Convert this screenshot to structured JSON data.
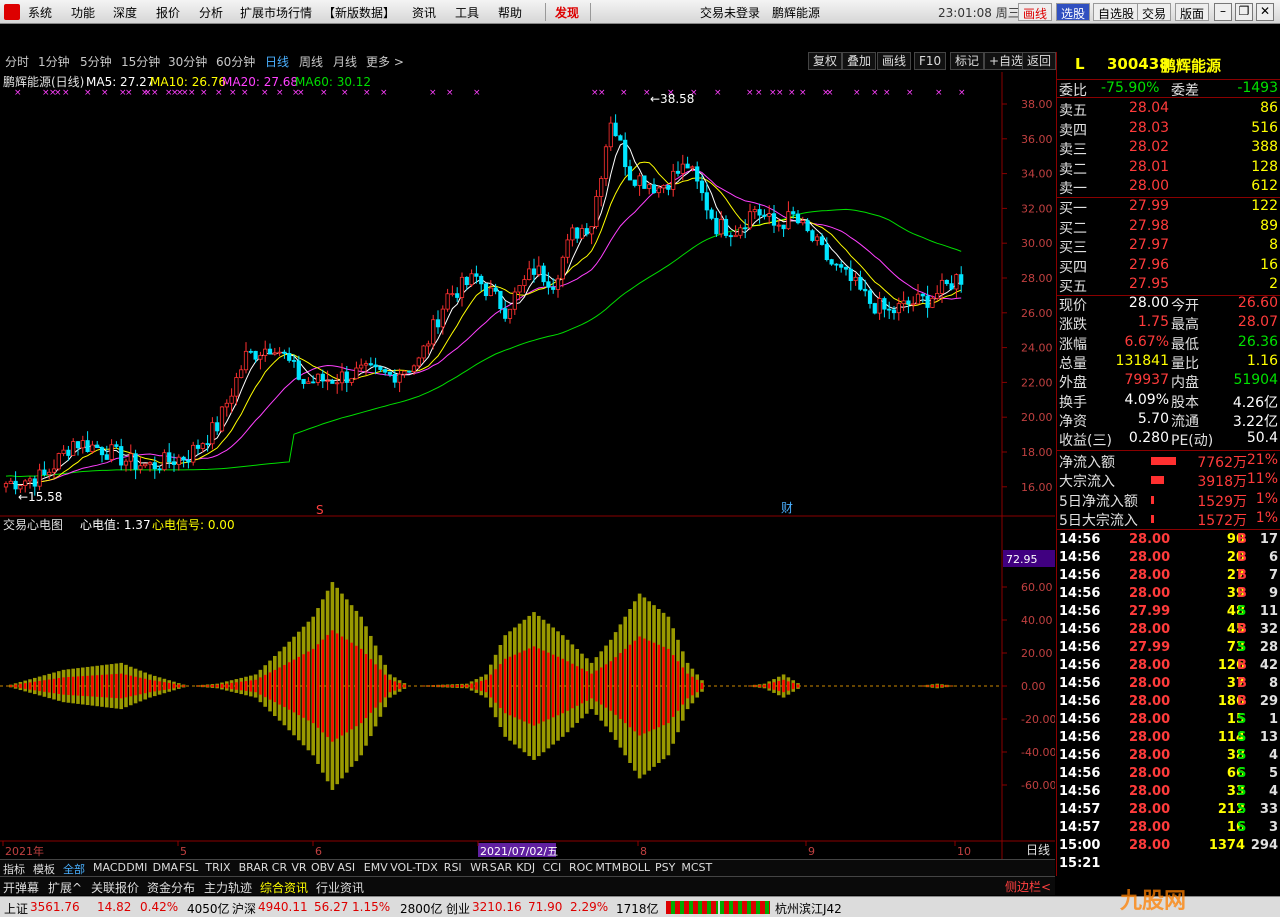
{
  "menu": {
    "items": [
      "系统",
      "功能",
      "深度",
      "报价",
      "分析",
      "扩展市场行情",
      "【新版数据】",
      "资讯",
      "工具",
      "帮助"
    ],
    "discover": "发现",
    "center": "交易未登录　鹏辉能源",
    "time": "23:01:08 周三",
    "right_buttons": [
      "画线",
      "选股",
      "自选股",
      "交易",
      "版面"
    ]
  },
  "periods": [
    "分时",
    "1分钟",
    "5分钟",
    "15分钟",
    "30分钟",
    "60分钟",
    "日线",
    "周线",
    "月线",
    "更多 >"
  ],
  "toolbar": [
    "复权",
    "叠加",
    "画线",
    "F10",
    "标记",
    "+自选",
    "返回"
  ],
  "main_legend": {
    "name": "鹏辉能源(日线)",
    "ma5": "MA5: 27.27",
    "ma10": "MA10: 26.76",
    "ma20": "MA20: 27.68",
    "ma60": "MA60: 30.12"
  },
  "colors": {
    "up": "#ff3030",
    "down": "#00e5ff",
    "ma5": "#ffffff",
    "ma10": "#ffff00",
    "ma20": "#ff40ff",
    "ma60": "#00dd00",
    "ind_red": "#ff0000",
    "ind_olive": "#999900"
  },
  "chart_data": [
    {
      "type": "candlestick",
      "title": "鹏辉能源(日线)",
      "ylim": [
        15,
        39
      ],
      "y_ticks": [
        "38.00",
        "36.00",
        "34.00",
        "32.00",
        "30.00",
        "28.00",
        "26.00",
        "24.00",
        "22.00",
        "20.00",
        "18.00",
        "16.00"
      ],
      "annotations": {
        "high": "38.58",
        "low": "15.58",
        "markers": [
          "S",
          "财"
        ]
      },
      "series": [
        {
          "name": "MA5",
          "last": 27.27
        },
        {
          "name": "MA10",
          "last": 26.76
        },
        {
          "name": "MA20",
          "last": 27.68
        },
        {
          "name": "MA60",
          "last": 30.12
        }
      ],
      "x_labels": [
        "2021年",
        "5",
        "6",
        "2021/07/02/五",
        "8",
        "9",
        "10"
      ],
      "anchors": [
        [
          0,
          16.2
        ],
        [
          8,
          16.6
        ],
        [
          14,
          18.6
        ],
        [
          20,
          18.2
        ],
        [
          26,
          17.4
        ],
        [
          30,
          17.2
        ],
        [
          38,
          17.8
        ],
        [
          44,
          19.5
        ],
        [
          50,
          23.5
        ],
        [
          56,
          24.2
        ],
        [
          62,
          22.0
        ],
        [
          68,
          22.2
        ],
        [
          74,
          22.6
        ],
        [
          80,
          22.4
        ],
        [
          86,
          23.2
        ],
        [
          92,
          27.0
        ],
        [
          98,
          28.0
        ],
        [
          104,
          26.2
        ],
        [
          110,
          28.5
        ],
        [
          114,
          27.8
        ],
        [
          118,
          30.5
        ],
        [
          122,
          31.2
        ],
        [
          126,
          37.2
        ],
        [
          130,
          34.0
        ],
        [
          136,
          33.2
        ],
        [
          142,
          34.5
        ],
        [
          148,
          31.0
        ],
        [
          152,
          30.8
        ],
        [
          156,
          32.0
        ],
        [
          160,
          31.0
        ],
        [
          164,
          31.5
        ],
        [
          168,
          30.2
        ],
        [
          172,
          28.8
        ],
        [
          176,
          27.8
        ],
        [
          180,
          26.6
        ],
        [
          184,
          26.0
        ],
        [
          188,
          26.5
        ],
        [
          192,
          26.8
        ],
        [
          196,
          27.5
        ],
        [
          198,
          28.0
        ]
      ]
    },
    {
      "type": "bar",
      "title": "交易心电图",
      "legend": {
        "value": "心电值: 1.37",
        "signal": "心电信号: 0.00"
      },
      "ylim": [
        -60,
        70
      ],
      "y_ticks": [
        "60.00",
        "40.00",
        "20.00",
        "0.00",
        "-20.00",
        "-40.00",
        "-60.00"
      ],
      "current": "72.95",
      "anchors": [
        [
          0,
          0
        ],
        [
          12,
          7
        ],
        [
          24,
          10
        ],
        [
          30,
          5
        ],
        [
          38,
          0
        ],
        [
          44,
          1
        ],
        [
          52,
          5
        ],
        [
          58,
          17
        ],
        [
          64,
          30
        ],
        [
          68,
          45
        ],
        [
          74,
          30
        ],
        [
          80,
          5
        ],
        [
          84,
          0
        ],
        [
          96,
          1
        ],
        [
          100,
          5
        ],
        [
          104,
          22
        ],
        [
          110,
          32
        ],
        [
          116,
          22
        ],
        [
          122,
          10
        ],
        [
          126,
          20
        ],
        [
          132,
          40
        ],
        [
          138,
          30
        ],
        [
          142,
          10
        ],
        [
          146,
          0
        ],
        [
          154,
          0
        ],
        [
          158,
          1
        ],
        [
          162,
          5
        ],
        [
          166,
          0
        ],
        [
          190,
          0
        ],
        [
          194,
          1
        ],
        [
          198,
          0
        ]
      ]
    }
  ],
  "right_panel": {
    "code": "300438",
    "name": "鹏辉能源",
    "flag": "L",
    "weibi": {
      "label": "委比",
      "value": "-75.90%",
      "label2": "委差",
      "value2": "-1493"
    },
    "asks": [
      {
        "label": "卖五",
        "price": "28.04",
        "vol": "86"
      },
      {
        "label": "卖四",
        "price": "28.03",
        "vol": "516"
      },
      {
        "label": "卖三",
        "price": "28.02",
        "vol": "388"
      },
      {
        "label": "卖二",
        "price": "28.01",
        "vol": "128"
      },
      {
        "label": "卖一",
        "price": "28.00",
        "vol": "612"
      }
    ],
    "bids": [
      {
        "label": "买一",
        "price": "27.99",
        "vol": "122"
      },
      {
        "label": "买二",
        "price": "27.98",
        "vol": "89"
      },
      {
        "label": "买三",
        "price": "27.97",
        "vol": "8"
      },
      {
        "label": "买四",
        "price": "27.96",
        "vol": "16"
      },
      {
        "label": "买五",
        "price": "27.95",
        "vol": "2"
      }
    ],
    "stats": [
      [
        "现价",
        "28.00",
        "今开",
        "26.60"
      ],
      [
        "涨跌",
        "1.75",
        "最高",
        "28.07"
      ],
      [
        "涨幅",
        "6.67%",
        "最低",
        "26.36"
      ],
      [
        "总量",
        "131841",
        "量比",
        "1.16"
      ],
      [
        "外盘",
        "79937",
        "内盘",
        "51904"
      ],
      [
        "换手",
        "4.09%",
        "股本",
        "4.26亿"
      ],
      [
        "净资",
        "5.70",
        "流通",
        "3.22亿"
      ],
      [
        "收益(三)",
        "0.280",
        "PE(动)",
        "50.4"
      ]
    ],
    "flows": [
      {
        "label": "净流入额",
        "value": "7762万",
        "pct": "21%",
        "bar": 0.95
      },
      {
        "label": "大宗流入",
        "value": "3918万",
        "pct": "11%",
        "bar": 0.5
      },
      {
        "label": "5日净流入额",
        "value": "1529万",
        "pct": "1%",
        "bar": 0.1
      },
      {
        "label": "5日大宗流入",
        "value": "1572万",
        "pct": "1%",
        "bar": 0.1
      }
    ],
    "ticks": [
      [
        "14:56",
        "28.00",
        "90",
        "B",
        "17"
      ],
      [
        "14:56",
        "28.00",
        "20",
        "B",
        "6"
      ],
      [
        "14:56",
        "28.00",
        "27",
        "B",
        "7"
      ],
      [
        "14:56",
        "28.00",
        "39",
        "B",
        "9"
      ],
      [
        "14:56",
        "27.99",
        "48",
        "S",
        "11"
      ],
      [
        "14:56",
        "28.00",
        "45",
        "B",
        "32"
      ],
      [
        "14:56",
        "27.99",
        "73",
        "S",
        "28"
      ],
      [
        "14:56",
        "28.00",
        "126",
        "B",
        "42"
      ],
      [
        "14:56",
        "28.00",
        "37",
        "B",
        "8"
      ],
      [
        "14:56",
        "28.00",
        "186",
        "B",
        "29"
      ],
      [
        "14:56",
        "28.00",
        "15",
        "S",
        "1"
      ],
      [
        "14:56",
        "28.00",
        "114",
        "S",
        "13"
      ],
      [
        "14:56",
        "28.00",
        "38",
        "S",
        "4"
      ],
      [
        "14:56",
        "28.00",
        "66",
        "S",
        "5"
      ],
      [
        "14:56",
        "28.00",
        "33",
        "S",
        "4"
      ],
      [
        "14:57",
        "28.00",
        "212",
        "S",
        "33"
      ],
      [
        "14:57",
        "28.00",
        "16",
        "S",
        "3"
      ],
      [
        "15:00",
        "28.00",
        "1374",
        "",
        "294"
      ],
      [
        "15:21",
        "",
        "",
        "",
        ""
      ]
    ]
  },
  "indicators": [
    "指标",
    "模板",
    "全部",
    "MACD",
    "DMI",
    "DMA",
    "FSL",
    "TRIX",
    "BRAR",
    "CR",
    "VR",
    "OBV",
    "ASI",
    "EMV",
    "VOL-TDX",
    "RSI",
    "WR",
    "SAR",
    "KDJ",
    "CCI",
    "ROC",
    "MTM",
    "BOLL",
    "PSY",
    "MCST"
  ],
  "bottom_tabs": [
    "开弹幕",
    "扩展^",
    "关联报价",
    "资金分布",
    "主力轨迹",
    "综合资讯",
    "行业资讯"
  ],
  "status": {
    "sh_label": "上证",
    "sh": "3561.76",
    "sh_chg": "14.82",
    "sh_pct": "0.42%",
    "sh_amt": "4050亿",
    "hs_label": "沪深",
    "hs": "4940.11",
    "hs_chg": "56.27",
    "hs_pct": "1.15%",
    "hs_amt": "2800亿",
    "cy_label": "创业",
    "cy": "3210.16",
    "cy_chg": "71.90",
    "cy_pct": "2.29%",
    "cy_amt": "1718亿",
    "loc": "杭州滨江J42"
  },
  "side_label": "侧边栏<",
  "period_right": "日线",
  "watermark": "九股网"
}
